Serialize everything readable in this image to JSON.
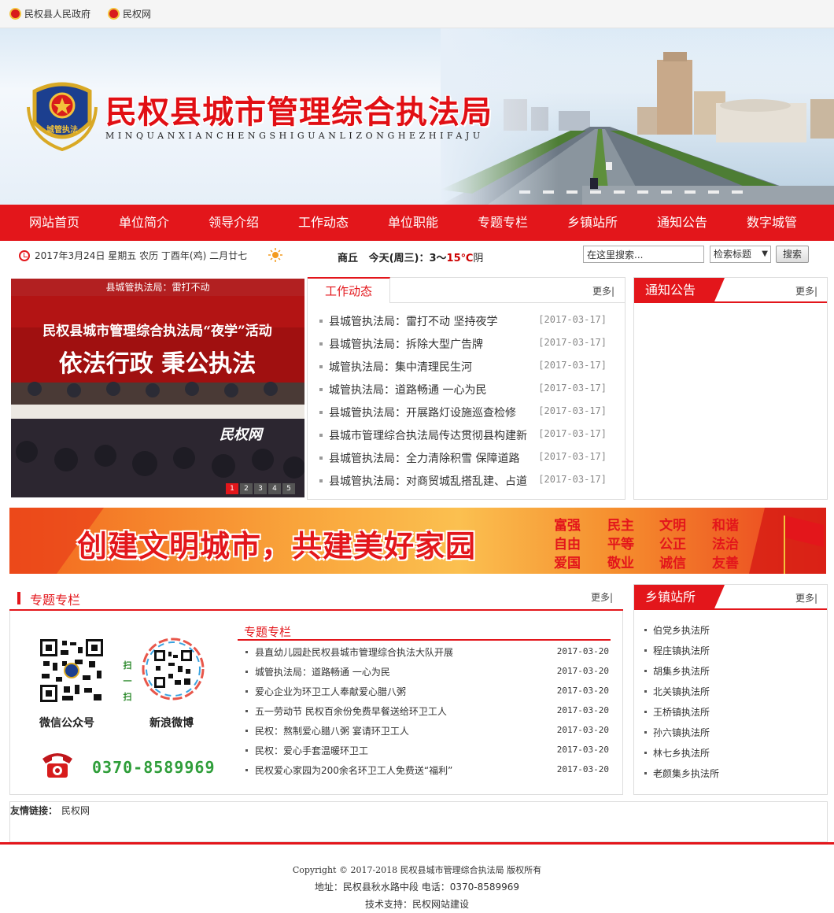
{
  "topbar": {
    "links": [
      "民权县人民政府",
      "民权网"
    ]
  },
  "header": {
    "title": "民权县城市管理综合执法局",
    "subtitle": "MINQUANXIANCHENGSHIGUANLIZONGHEZHIFAJU",
    "badge_text": "城管执法"
  },
  "nav": {
    "items": [
      "网站首页",
      "单位简介",
      "领导介绍",
      "工作动态",
      "单位职能",
      "专题专栏",
      "乡镇站所",
      "通知公告",
      "数字城管"
    ]
  },
  "info": {
    "date": "2017年3月24日 星期五 农历 丁酉年(鸡) 二月廿七",
    "city": "商丘",
    "day": "今天(周三)：",
    "temp_low": "3～",
    "temp_high": "15℃",
    "cond": "阴"
  },
  "search": {
    "value": "在这里搜索...",
    "select": "检索标题",
    "button": "搜索"
  },
  "slider": {
    "caption": "县城管执法局：雷打不动",
    "pages": [
      "1",
      "2",
      "3",
      "4",
      "5"
    ],
    "active_page": 1,
    "photo_banner": "民权县城市管理综合执法局“夜学”活动",
    "photo_slogan": "依法行政   秉公执法",
    "watermark": "民权网"
  },
  "news": {
    "tab": "工作动态",
    "more": "更多|",
    "items": [
      {
        "title": "县城管执法局：雷打不动 坚持夜学",
        "date": "[2017-03-17]"
      },
      {
        "title": "县城管执法局：拆除大型广告牌",
        "date": "[2017-03-17]"
      },
      {
        "title": "城管执法局：集中清理民生河",
        "date": "[2017-03-17]"
      },
      {
        "title": "城管执法局：道路畅通 一心为民",
        "date": "[2017-03-17]"
      },
      {
        "title": "县城管执法局：开展路灯设施巡查检修",
        "date": "[2017-03-17]"
      },
      {
        "title": "县城市管理综合执法局传达贯彻县构建新",
        "date": "[2017-03-17]"
      },
      {
        "title": "县城管执法局：全力清除积雪 保障道路",
        "date": "[2017-03-17]"
      },
      {
        "title": "县城管执法局：对商贸城乱搭乱建、占道",
        "date": "[2017-03-17]"
      }
    ]
  },
  "notice": {
    "title": "通知公告",
    "more": "更多|"
  },
  "ad": {
    "slogan": "创建文明城市，共建美好家园",
    "values": [
      "富强",
      "民主",
      "文明",
      "和谐",
      "自由",
      "平等",
      "公正",
      "法治",
      "爱国",
      "敬业",
      "诚信",
      "友善"
    ]
  },
  "special": {
    "title": "专题专栏",
    "more": "更多|",
    "sub_title": "专题专栏",
    "wechat_label": "微信公众号",
    "weibo_label": "新浪微博",
    "scan": [
      "扫",
      "一",
      "扫"
    ],
    "phone": "0370-8589969",
    "items": [
      {
        "title": "县直幼儿园赴民权县城市管理综合执法大队开展",
        "date": "2017-03-20"
      },
      {
        "title": "城管执法局：道路畅通 一心为民",
        "date": "2017-03-20"
      },
      {
        "title": "爱心企业为环卫工人奉献爱心腊八粥",
        "date": "2017-03-20"
      },
      {
        "title": "五一劳动节 民权百余份免费早餐送给环卫工人",
        "date": "2017-03-20"
      },
      {
        "title": "民权：熬制爱心腊八粥 宴请环卫工人",
        "date": "2017-03-20"
      },
      {
        "title": "民权：爱心手套温暖环卫工",
        "date": "2017-03-20"
      },
      {
        "title": "民权爱心家园为200余名环卫工人免费送“福利”",
        "date": "2017-03-20"
      }
    ]
  },
  "towns": {
    "title": "乡镇站所",
    "more": "更多|",
    "items": [
      "伯党乡执法所",
      "程庄镇执法所",
      "胡集乡执法所",
      "北关镇执法所",
      "王桥镇执法所",
      "孙六镇执法所",
      "林七乡执法所",
      "老颜集乡执法所"
    ]
  },
  "friend": {
    "label": "友情链接：",
    "link": "民权网"
  },
  "footer": {
    "copyright": "Copyright © 2017-2018 民权县城市管理综合执法局 版权所有",
    "address": "地址：民权县秋水路中段 电话：0370-8589969",
    "support": "技术支持：民权网站建设"
  },
  "colors": {
    "brand_red": "#e3161b",
    "phone_green": "#2f9e3a"
  }
}
